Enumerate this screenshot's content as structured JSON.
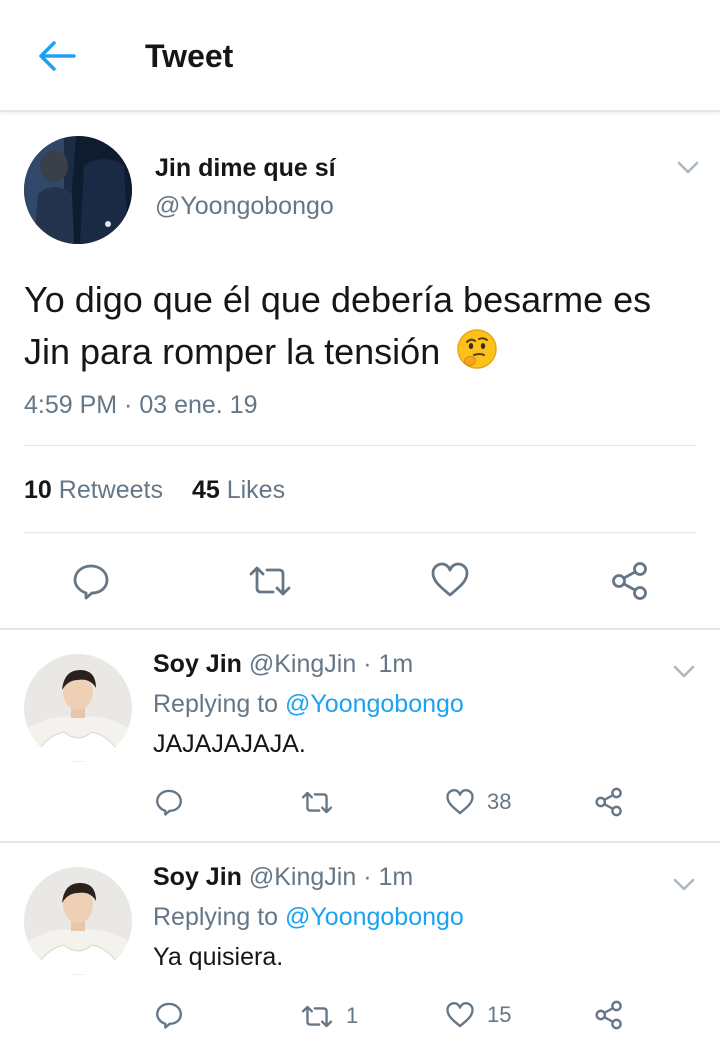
{
  "header": {
    "title": "Tweet",
    "back_icon": "arrow-left-icon",
    "accent": "#1da1f2"
  },
  "tweet": {
    "author_name": "Jin dime que sí",
    "author_handle": "@Yoongobongo",
    "text": "Yo digo que él que debería besarme es Jin para romper la tensión",
    "emoji": "thinking-face-emoji",
    "timestamp": "4:59 PM · 03 ene. 19",
    "retweets_count": "10",
    "retweets_label": "Retweets",
    "likes_count": "45",
    "likes_label": "Likes"
  },
  "replies": [
    {
      "author_name": "Soy Jin",
      "author_handle": "@KingJin",
      "time": "· 1m",
      "replying_label": "Replying to",
      "replying_handle": "@Yoongobongo",
      "text": "JAJAJAJAJA.",
      "retweets": "",
      "likes": "38"
    },
    {
      "author_name": "Soy Jin",
      "author_handle": "@KingJin",
      "time": "· 1m",
      "replying_label": "Replying to",
      "replying_handle": "@Yoongobongo",
      "text": "Ya quisiera.",
      "retweets": "1",
      "likes": "15"
    }
  ],
  "colors": {
    "text": "#14171a",
    "secondary": "#657786",
    "link": "#1da1f2",
    "divider": "#e1e8ed"
  }
}
